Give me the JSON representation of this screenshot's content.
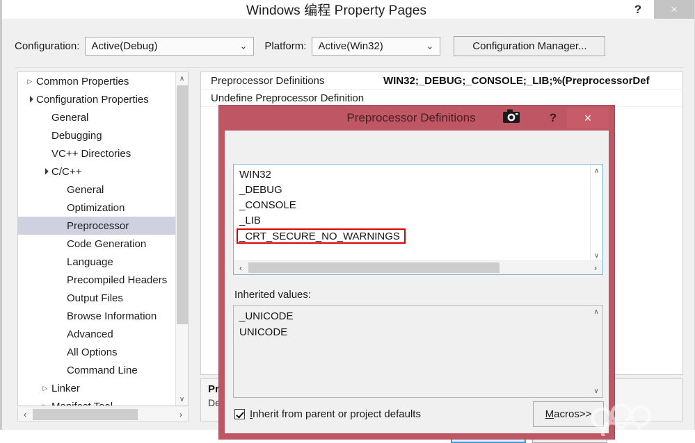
{
  "window": {
    "title": "Windows 编程 Property Pages",
    "help_label": "?",
    "close_label": "×"
  },
  "config_bar": {
    "configuration_label": "Configuration:",
    "configuration_value": "Active(Debug)",
    "platform_label": "Platform:",
    "platform_value": "Active(Win32)",
    "configuration_manager_label": "Configuration Manager...",
    "caret_glyph": "⌄"
  },
  "tree": {
    "items": [
      {
        "label": "Common Properties",
        "indent": 0,
        "arrow": "collapsed",
        "selected": false
      },
      {
        "label": "Configuration Properties",
        "indent": 0,
        "arrow": "expanded",
        "selected": false
      },
      {
        "label": "General",
        "indent": 1,
        "arrow": "none",
        "selected": false
      },
      {
        "label": "Debugging",
        "indent": 1,
        "arrow": "none",
        "selected": false
      },
      {
        "label": "VC++ Directories",
        "indent": 1,
        "arrow": "none",
        "selected": false
      },
      {
        "label": "C/C++",
        "indent": 1,
        "arrow": "expanded",
        "selected": false
      },
      {
        "label": "General",
        "indent": 2,
        "arrow": "none",
        "selected": false
      },
      {
        "label": "Optimization",
        "indent": 2,
        "arrow": "none",
        "selected": false
      },
      {
        "label": "Preprocessor",
        "indent": 2,
        "arrow": "none",
        "selected": true
      },
      {
        "label": "Code Generation",
        "indent": 2,
        "arrow": "none",
        "selected": false
      },
      {
        "label": "Language",
        "indent": 2,
        "arrow": "none",
        "selected": false
      },
      {
        "label": "Precompiled Headers",
        "indent": 2,
        "arrow": "none",
        "selected": false
      },
      {
        "label": "Output Files",
        "indent": 2,
        "arrow": "none",
        "selected": false
      },
      {
        "label": "Browse Information",
        "indent": 2,
        "arrow": "none",
        "selected": false
      },
      {
        "label": "Advanced",
        "indent": 2,
        "arrow": "none",
        "selected": false
      },
      {
        "label": "All Options",
        "indent": 2,
        "arrow": "none",
        "selected": false
      },
      {
        "label": "Command Line",
        "indent": 2,
        "arrow": "none",
        "selected": false
      },
      {
        "label": "Linker",
        "indent": 1,
        "arrow": "collapsed",
        "selected": false
      },
      {
        "label": "Manifest Tool",
        "indent": 1,
        "arrow": "collapsed",
        "selected": false
      }
    ],
    "scroll_up_glyph": "∧",
    "scroll_down_glyph": "∨",
    "scroll_left_glyph": "‹",
    "scroll_right_glyph": "›"
  },
  "properties": {
    "rows": [
      {
        "name": "Preprocessor Definitions",
        "value": "WIN32;_DEBUG;_CONSOLE;_LIB;%(PreprocessorDef"
      },
      {
        "name": "Undefine Preprocessor Definition",
        "value": ""
      }
    ]
  },
  "description": {
    "title": "Pr",
    "body": "De"
  },
  "footer": {
    "ok_label": "",
    "cancel_label": ""
  },
  "dialog": {
    "title": "Preprocessor Definitions",
    "help_label": "?",
    "close_label": "×",
    "camera_icon": "camera-icon",
    "definitions": [
      {
        "text": "WIN32",
        "highlighted": false
      },
      {
        "text": "_DEBUG",
        "highlighted": false
      },
      {
        "text": "_CONSOLE",
        "highlighted": false
      },
      {
        "text": "_LIB",
        "highlighted": false
      },
      {
        "text": "_CRT_SECURE_NO_WARNINGS",
        "highlighted": true
      }
    ],
    "inherited_label": "Inherited values:",
    "inherited_values": [
      "_UNICODE",
      "UNICODE"
    ],
    "inherit_checkbox_checked": true,
    "inherit_checkbox_label_prefix": "",
    "inherit_checkbox_label_accel": "I",
    "inherit_checkbox_label_rest": "nherit from parent or project defaults",
    "macros_label_accel": "M",
    "macros_label_rest": "acros>>",
    "scroll_up_glyph": "∧",
    "scroll_down_glyph": "∨",
    "scroll_left_glyph": "‹",
    "scroll_right_glyph": "›"
  },
  "colors": {
    "dialog_frame": "#bf5663",
    "dialog_close": "#c75c68",
    "highlight_box": "#e00000",
    "tree_selection": "#cfd1e0",
    "ok_button_border": "#3a9ce0"
  }
}
